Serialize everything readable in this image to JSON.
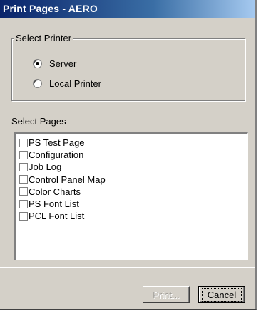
{
  "window": {
    "title": "Print Pages - AERO"
  },
  "select_printer": {
    "legend": "Select Printer",
    "options": [
      {
        "label": "Server",
        "selected": true
      },
      {
        "label": "Local Printer",
        "selected": false
      }
    ]
  },
  "select_pages": {
    "label": "Select Pages",
    "items": [
      {
        "label": "PS Test Page",
        "checked": false
      },
      {
        "label": "Configuration",
        "checked": false
      },
      {
        "label": "Job Log",
        "checked": false
      },
      {
        "label": "Control Panel Map",
        "checked": false
      },
      {
        "label": "Color Charts",
        "checked": false
      },
      {
        "label": "PS Font List",
        "checked": false
      },
      {
        "label": "PCL Font List",
        "checked": false
      }
    ]
  },
  "buttons": {
    "print_label": "Print...",
    "print_enabled": false,
    "cancel_label": "Cancel"
  }
}
